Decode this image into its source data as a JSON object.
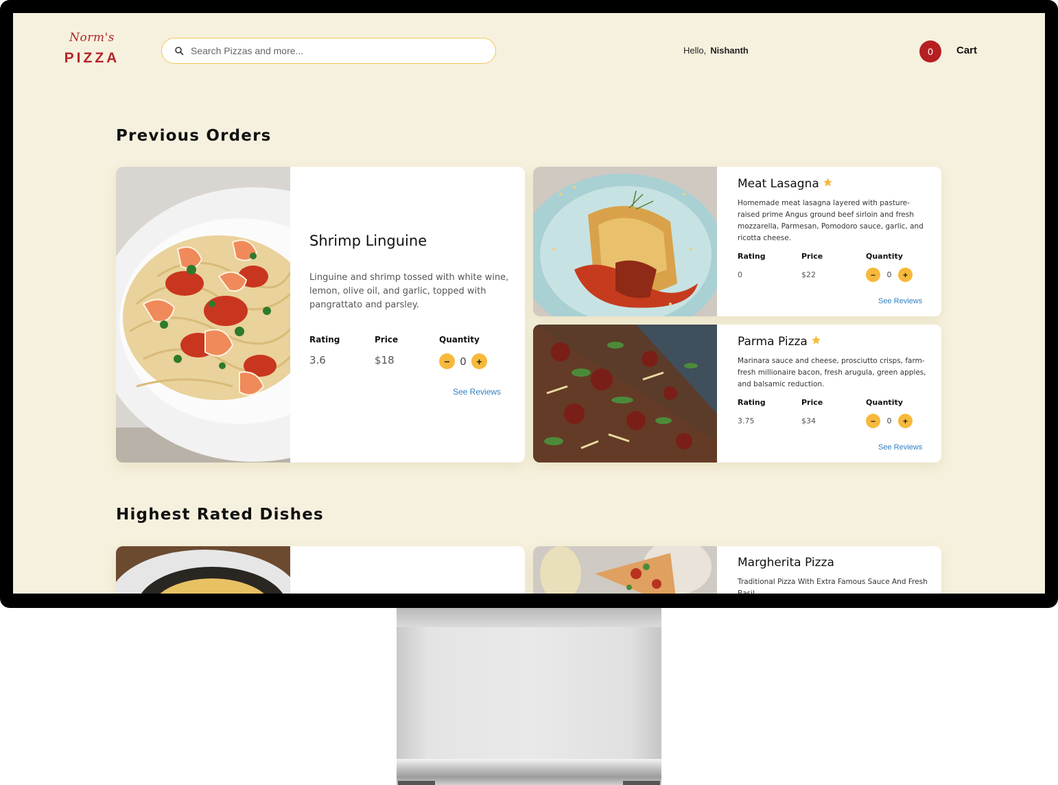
{
  "header": {
    "logo_script": "Norm's",
    "logo_main": "PIZZA",
    "search_placeholder": "Search Pizzas and more...",
    "greeting": "Hello,",
    "user_name": "Nishanth",
    "cart_count": "0",
    "cart_label": "Cart"
  },
  "sections": {
    "previous_orders_title": "Previous Orders",
    "highest_rated_title": "Highest Rated Dishes"
  },
  "labels": {
    "rating": "Rating",
    "price": "Price",
    "quantity": "Quantity",
    "see_reviews": "See Reviews",
    "minus": "−",
    "plus": "+"
  },
  "previous_orders": [
    {
      "title": "Shrimp Linguine",
      "description": "Linguine and shrimp tossed with white wine, lemon, olive oil, and garlic, topped with pangrattato and parsley.",
      "rating": "3.6",
      "price": "$18",
      "quantity": "0"
    },
    {
      "title": "Meat Lasagna",
      "description": "Homemade meat lasagna layered with pasture-raised prime Angus ground beef sirloin and fresh mozzarella, Parmesan, Pomodoro sauce, garlic, and ricotta cheese.",
      "rating": "0",
      "price": "$22",
      "quantity": "0"
    },
    {
      "title": "Parma Pizza",
      "description": "Marinara sauce and cheese, prosciutto crisps, farm-fresh millionaire bacon, fresh arugula, green apples, and balsamic reduction.",
      "rating": "3.75",
      "price": "$34",
      "quantity": "0"
    }
  ],
  "highest_rated": [
    {
      "title": "Margherita Pizza",
      "description": "Traditional Pizza With Extra Famous Sauce And Fresh Basil"
    }
  ],
  "colors": {
    "background": "#f6f1de",
    "brand_red": "#b3262b",
    "accent_yellow": "#f6b93b",
    "link_blue": "#2f7fc3"
  }
}
